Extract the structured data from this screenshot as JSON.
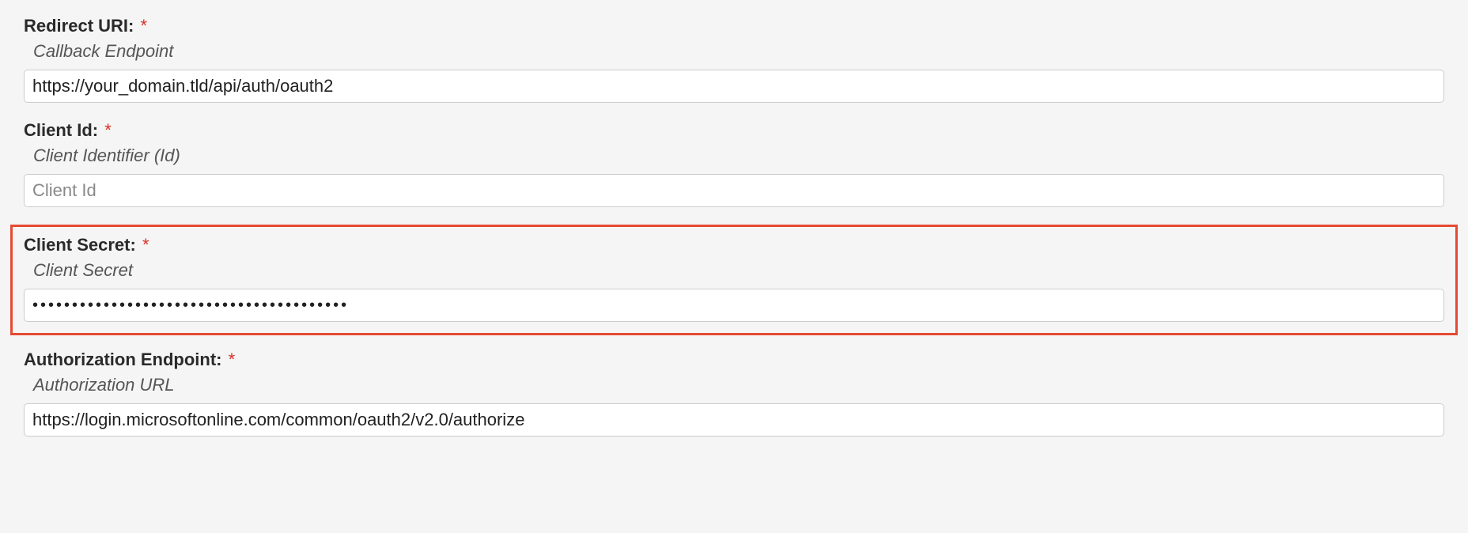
{
  "fields": {
    "redirect_uri": {
      "label": "Redirect URI:",
      "required": "*",
      "description": "Callback Endpoint",
      "value": "https://your_domain.tld/api/auth/oauth2",
      "placeholder": ""
    },
    "client_id": {
      "label": "Client Id:",
      "required": "*",
      "description": "Client Identifier (Id)",
      "value": "",
      "placeholder": "Client Id"
    },
    "client_secret": {
      "label": "Client Secret:",
      "required": "*",
      "description": "Client Secret",
      "value": "••••••••••••••••••••••••••••••••••••••••",
      "placeholder": ""
    },
    "auth_endpoint": {
      "label": "Authorization Endpoint:",
      "required": "*",
      "description": "Authorization URL",
      "value": "https://login.microsoftonline.com/common/oauth2/v2.0/authorize",
      "placeholder": ""
    }
  }
}
